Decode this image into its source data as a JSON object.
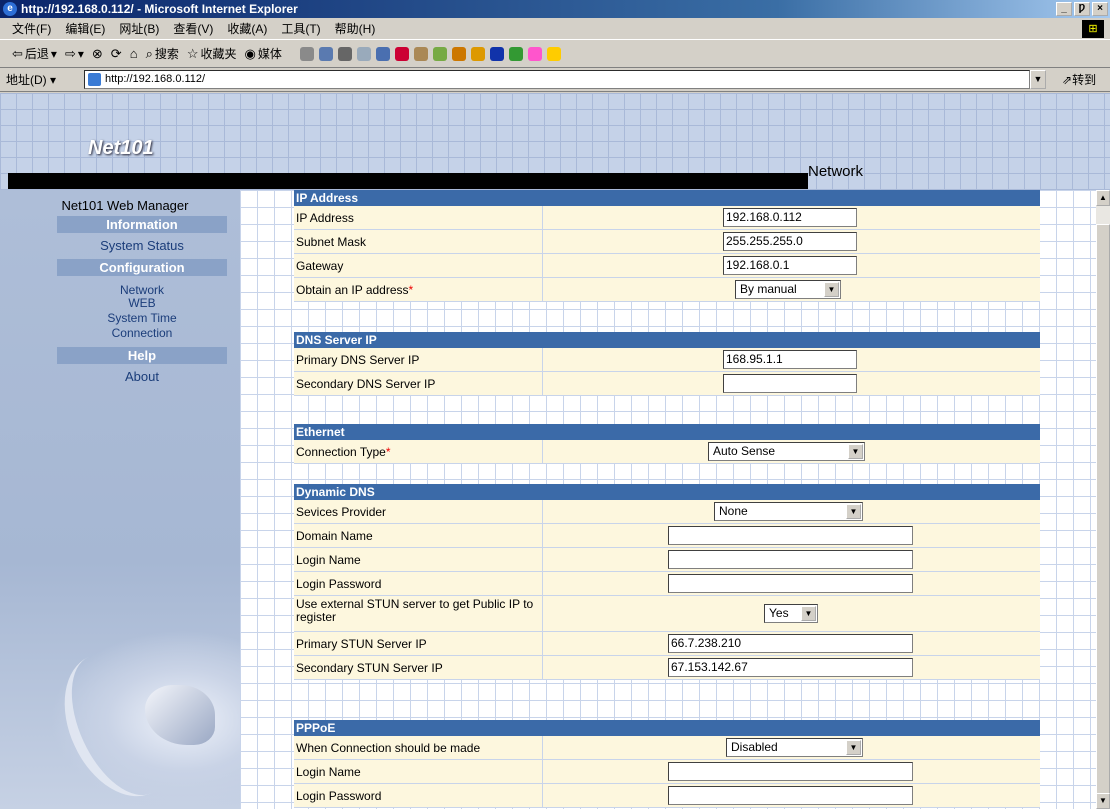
{
  "window": {
    "title": "http://192.168.0.112/ - Microsoft Internet Explorer",
    "controls": [
      "_",
      "Ƿ",
      "×"
    ]
  },
  "menu": [
    "文件(F)",
    "编辑(E)",
    "网址(B)",
    "查看(V)",
    "收藏(A)",
    "工具(T)",
    "帮助(H)"
  ],
  "toolbar": {
    "back": "后退",
    "search": "搜索",
    "favorites": "收藏夹",
    "media": "媒体"
  },
  "address": {
    "label": "地址(D)",
    "url": "http://192.168.0.112/",
    "go": "转到"
  },
  "banner": {
    "logo": "Net101",
    "section": "Network"
  },
  "sidebar": {
    "title": "Net101 Web Manager",
    "information": "Information",
    "system_status": "System Status",
    "configuration": "Configuration",
    "network": "Network",
    "web": "WEB",
    "system_time": "System Time",
    "connection": "Connection",
    "help": "Help",
    "about": "About"
  },
  "ip": {
    "header": "IP Address",
    "ip_label": "IP Address",
    "ip_value": "192.168.0.112",
    "mask_label": "Subnet Mask",
    "mask_value": "255.255.255.0",
    "gw_label": "Gateway",
    "gw_value": "192.168.0.1",
    "obtain_label": "Obtain an IP address",
    "obtain_value": "By manual"
  },
  "dns": {
    "header": "DNS Server IP",
    "primary_label": "Primary DNS Server IP",
    "primary_value": "168.95.1.1",
    "secondary_label": "Secondary DNS Server IP",
    "secondary_value": ""
  },
  "ethernet": {
    "header": "Ethernet",
    "conn_label": "Connection Type",
    "conn_value": "Auto Sense"
  },
  "ddns": {
    "header": "Dynamic DNS",
    "provider_label": "Sevices Provider",
    "provider_value": "None",
    "domain_label": "Domain Name",
    "domain_value": "",
    "login_label": "Login Name",
    "login_value": "",
    "password_label": "Login Password",
    "password_value": "",
    "stun_label": "Use external STUN server to get Public IP to register",
    "stun_value": "Yes",
    "pstun_label": "Primary STUN Server IP",
    "pstun_value": "66.7.238.210",
    "sstun_label": "Secondary STUN Server IP",
    "sstun_value": "67.153.142.67"
  },
  "pppoe": {
    "header": "PPPoE",
    "when_label": "When Connection should be made",
    "when_value": "Disabled",
    "login_label": "Login Name",
    "login_value": "",
    "password_label": "Login Password",
    "password_value": ""
  }
}
